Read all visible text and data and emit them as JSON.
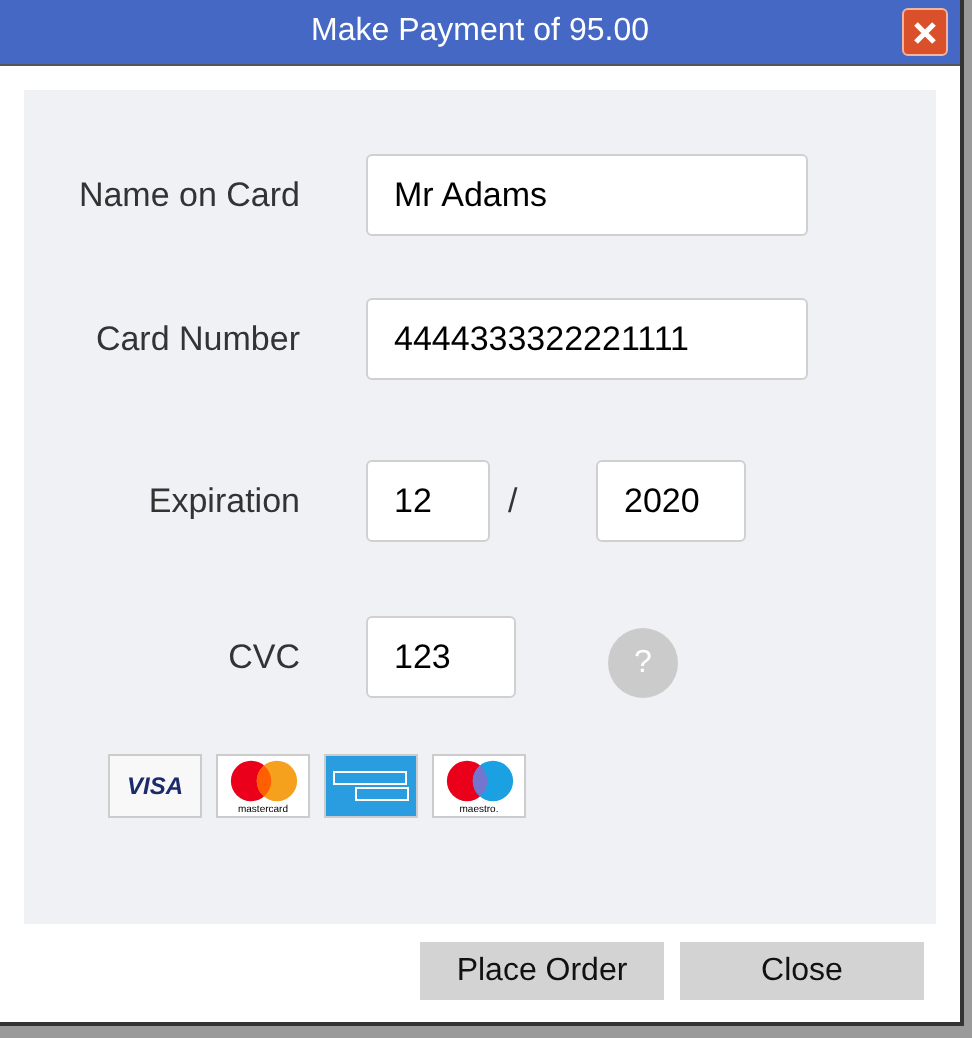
{
  "window": {
    "title": "Make Payment of 95.00"
  },
  "fields": [
    {
      "kind": "text",
      "label": "Name on Card",
      "value": "Mr Adams"
    },
    {
      "kind": "text",
      "label": "Card Number",
      "value": "4444333322221111"
    },
    {
      "kind": "expiry",
      "label": "Expiration",
      "month": "12",
      "separator": "/",
      "year": "2020"
    },
    {
      "kind": "cvc",
      "label": "CVC",
      "value": "123",
      "help": "?"
    }
  ],
  "cards": [
    {
      "kind": "visa",
      "label": "VISA"
    },
    {
      "kind": "mastercard",
      "label": "mastercard"
    },
    {
      "kind": "amex"
    },
    {
      "kind": "maestro",
      "label": "maestro."
    }
  ],
  "buttons": [
    "Place Order",
    "Close"
  ]
}
